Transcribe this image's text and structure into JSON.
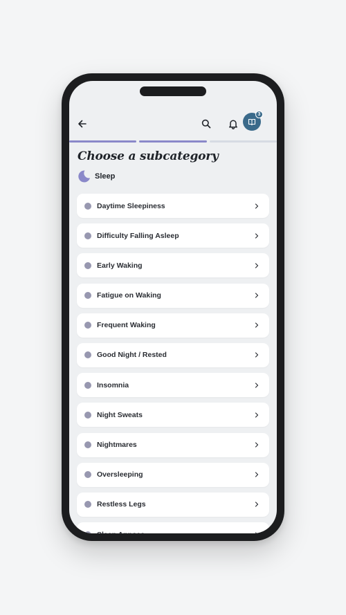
{
  "header": {
    "journal_badge_count": "3",
    "icons": [
      "arrow-left-icon",
      "search-icon",
      "bell-icon",
      "journal-icon"
    ]
  },
  "progress": {
    "total_steps": 3,
    "completed_steps": 2,
    "accent_color": "#8a88c9"
  },
  "page": {
    "title": "Choose a subcategory",
    "category_name": "Sleep",
    "category_icon": "moon-icon"
  },
  "subcategories": [
    {
      "label": "Daytime Sleepiness"
    },
    {
      "label": "Difficulty Falling Asleep"
    },
    {
      "label": "Early Waking"
    },
    {
      "label": "Fatigue on Waking"
    },
    {
      "label": "Frequent Waking"
    },
    {
      "label": "Good Night / Rested"
    },
    {
      "label": "Insomnia"
    },
    {
      "label": "Night Sweats"
    },
    {
      "label": "Nightmares"
    },
    {
      "label": "Oversleeping"
    },
    {
      "label": "Restless Legs"
    },
    {
      "label": "Sleep Apnoea"
    }
  ],
  "colors": {
    "background": "#eef0f2",
    "card": "#ffffff",
    "bullet": "#9898b0",
    "journal_button": "#3a6a8a"
  }
}
